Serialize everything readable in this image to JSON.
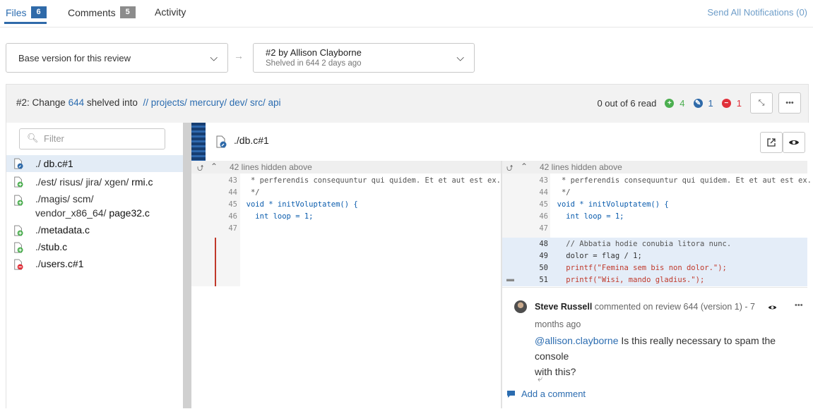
{
  "tabs": [
    {
      "label": "Files",
      "count": "6"
    },
    {
      "label": "Comments",
      "count": "5"
    },
    {
      "label": "Activity"
    }
  ],
  "send_all": "Send All Notifications (0)",
  "version": {
    "base_label": "Base version for this review",
    "target_title": "#2 by Allison Clayborne",
    "target_sub": "Shelved in 644 2 days ago"
  },
  "review": {
    "prefix": "#2: Change",
    "change": "644",
    "mid": "shelved into",
    "path": "// projects/ mercury/ dev/ src/ api",
    "read_status": "0 out of 6 read",
    "added": "4",
    "edited": "1",
    "deleted": "1"
  },
  "filter_placeholder": "Filter",
  "files": [
    {
      "dir": "./",
      "name": "db.c#1",
      "type": "edit"
    },
    {
      "dir": "./est/ risus/ jira/ xgen/",
      "name": "rmi.c",
      "type": "add"
    },
    {
      "dir": "./magis/ scm/",
      "dir2": "vendor_x86_64/",
      "name": "page32.c",
      "type": "add"
    },
    {
      "dir": "./",
      "name": "metadata.c",
      "type": "add"
    },
    {
      "dir": "./",
      "name": "stub.c",
      "type": "add"
    },
    {
      "dir": "./",
      "name": "users.c#1",
      "type": "delete"
    }
  ],
  "diff": {
    "file_title": "./db.c#1",
    "hidden_left": "42 lines hidden above",
    "hidden_right": "42 lines hidden above",
    "left_lines": [
      {
        "n": "43",
        "code": " * perferendis consequuntur qui quidem. Et et aut est ex."
      },
      {
        "n": "44",
        "code": " */"
      },
      {
        "n": "45",
        "code": "void * initVoluptatem() {"
      },
      {
        "n": "46",
        "code": "  int loop = 1;"
      },
      {
        "n": "47",
        "code": ""
      }
    ],
    "right_lines": [
      {
        "n": "43",
        "code": " * perferendis consequuntur qui quidem. Et et aut est ex."
      },
      {
        "n": "44",
        "code": " */"
      },
      {
        "n": "45",
        "code": "void * initVoluptatem() {"
      },
      {
        "n": "46",
        "code": "  int loop = 1;"
      },
      {
        "n": "47",
        "code": ""
      },
      {
        "n": "48",
        "code": "  // Abbatia hodie conubia litora nunc."
      },
      {
        "n": "49",
        "code": "  dolor = flag / 1;"
      },
      {
        "n": "50",
        "code": "  printf(\"Femina sem bis non dolor.\");"
      },
      {
        "n": "51",
        "code": "  printf(\"Wisi, mando gladius.\");"
      }
    ]
  },
  "comment": {
    "author": "Steve Russell",
    "meta": "commented on review 644 (version 1) - 7",
    "time": "months ago",
    "mention": "@allison.clayborne",
    "body_line1": "Is this really necessary to spam the console",
    "body_line2": "with this?",
    "add_comment": "Add a comment"
  },
  "colors": {
    "accent": "#2f6aa9",
    "added": "#4caf50",
    "edited": "#2f6aa9",
    "deleted": "#e0303a"
  }
}
